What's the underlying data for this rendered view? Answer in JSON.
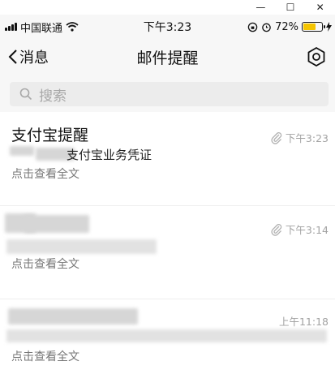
{
  "window": {
    "minimize": "—",
    "maximize": "☐",
    "close": "✕"
  },
  "status_bar": {
    "carrier": "中国联通",
    "time": "下午3:23",
    "battery_percent": "72%",
    "battery_level": 0.72
  },
  "nav": {
    "back_label": "消息",
    "title": "邮件提醒"
  },
  "search": {
    "placeholder": "搜索"
  },
  "mails": [
    {
      "title": "支付宝提醒",
      "time": "下午3:23",
      "preview_visible": "支付宝业务凭证",
      "footer": "点击查看全文",
      "has_attachment": true
    },
    {
      "title": "",
      "time": "下午3:14",
      "preview_visible": "",
      "footer": "点击查看全文",
      "has_attachment": true
    },
    {
      "title": "",
      "time": "上午11:18",
      "preview_visible": "",
      "footer": "点击查看全文",
      "has_attachment": false
    }
  ],
  "colors": {
    "accent_battery": "#f4c400",
    "muted_text": "#a3a3a3"
  }
}
